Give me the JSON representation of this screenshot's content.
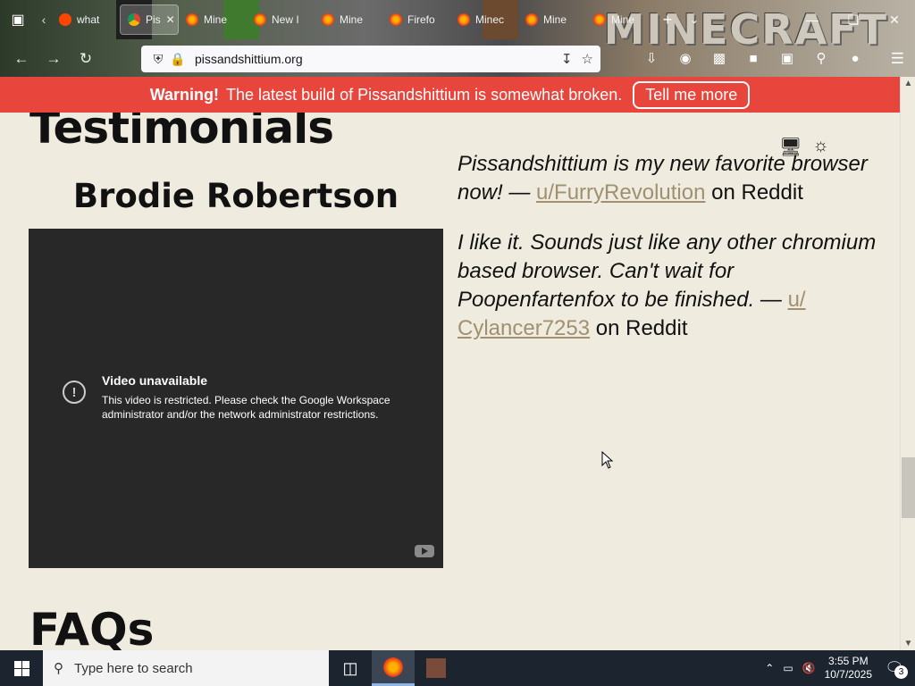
{
  "browser": {
    "tabs": [
      {
        "label": "what",
        "active": false
      },
      {
        "label": "Pis",
        "active": true
      },
      {
        "label": "Mine",
        "active": false
      },
      {
        "label": "New I",
        "active": false
      },
      {
        "label": "Mine",
        "active": false
      },
      {
        "label": "Firefo",
        "active": false
      },
      {
        "label": "Minec",
        "active": false
      },
      {
        "label": "Mine",
        "active": false
      },
      {
        "label": "Mine",
        "active": false
      }
    ],
    "url": "pissandshittium.org",
    "theme_deco_text": "MINECRAFT"
  },
  "banner": {
    "warning_label": "Warning!",
    "message": "The latest build of Pissandshittium is somewhat broken.",
    "button_label": "Tell me more"
  },
  "page": {
    "section_title": "Testimonials",
    "video_heading": "Brodie Robertson",
    "video": {
      "title": "Video unavailable",
      "description": "This video is restricted. Please check the Google Workspace administrator and/or the network administrator restrictions."
    },
    "quotes": [
      {
        "text": "Pissandshittium is my new favorite browser now! — ",
        "author": "u/FurryRevolution",
        "suffix": " on Reddit"
      },
      {
        "text": "I like it. Sounds just like any other chromium based browser. Can't wait for Poopenfartenfox to be finished. — ",
        "author": "u/ Cylancer7253",
        "suffix": " on Reddit"
      }
    ],
    "next_section_title": "FAQs"
  },
  "taskbar": {
    "search_placeholder": "Type here to search",
    "time": "3:55 PM",
    "date": "10/7/2025",
    "notification_count": "3"
  },
  "colors": {
    "banner": "#e8453c",
    "page_bg": "#efebdf",
    "link": "#a09070",
    "video_bg": "#282828"
  }
}
